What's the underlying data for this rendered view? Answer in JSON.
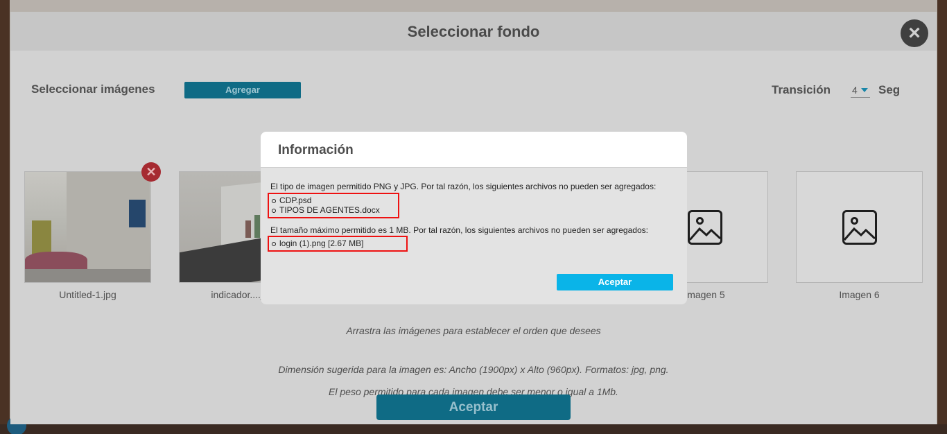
{
  "main_modal": {
    "title": "Seleccionar fondo",
    "select_images_label": "Seleccionar imágenes",
    "add_button": "Agregar",
    "transition_label": "Transición",
    "transition_value": "4",
    "seconds_label": "Seg",
    "thumbnails": [
      {
        "caption": "Untitled-1.jpg"
      },
      {
        "caption": "indicador....jpg"
      },
      {
        "caption": "Imagen 5"
      },
      {
        "caption": "Imagen 6"
      }
    ],
    "drag_hint": "Arrastra las imágenes para establecer el orden que desees",
    "dimension_hint": "Dimensión sugerida para la imagen es: Ancho (1900px) x Alto (960px). Formatos: jpg, png.",
    "weight_hint": "El peso permitido para cada imagen debe ser menor o igual a 1Mb.",
    "accept_button": "Aceptar"
  },
  "info_dialog": {
    "title": "Información",
    "type_message": "El tipo de imagen permitido PNG y JPG. Por tal razón, los siguientes archivos no pueden ser agregados:",
    "type_files": [
      "CDP.psd",
      "TIPOS DE AGENTES.docx"
    ],
    "size_message": "El tamaño máximo permitido es 1 MB. Por tal razón, los siguientes archivos no pueden ser agregados:",
    "size_files": [
      "login (1).png [2.67 MB]"
    ],
    "accept_button": "Aceptar"
  },
  "colors": {
    "primary_button": "#0ab4e8",
    "delete_badge": "#a62a31",
    "error_outline": "#e11111"
  },
  "icons": [
    "close-icon",
    "delete-icon",
    "image-placeholder-icon",
    "chevron-down-icon"
  ]
}
